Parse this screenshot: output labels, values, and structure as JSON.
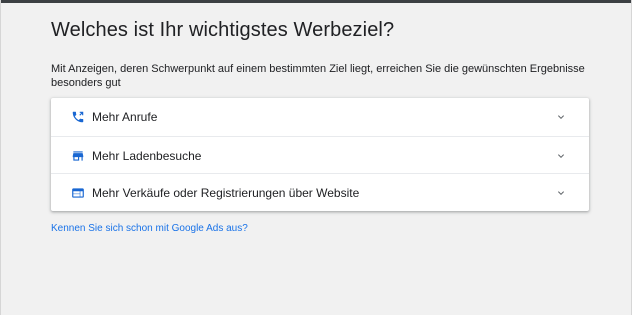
{
  "heading": "Welches ist Ihr wichtigstes Werbeziel?",
  "description": "Mit Anzeigen, deren Schwerpunkt auf einem bestimmten Ziel liegt, erreichen Sie die gewünschten Ergebnisse besonders gut",
  "goals": [
    {
      "label": "Mehr Anrufe",
      "icon": "phone-icon"
    },
    {
      "label": "Mehr Ladenbesuche",
      "icon": "store-icon"
    },
    {
      "label": "Mehr Verkäufe oder Registrierungen über Website",
      "icon": "web-icon"
    }
  ],
  "link_text": "Kennen Sie sich schon mit Google Ads aus?",
  "colors": {
    "accent": "#1a73e8",
    "icon_blue": "#1967d2",
    "background": "#f1f1f1",
    "card": "#ffffff",
    "text": "#202124",
    "chevron": "#5f6368"
  }
}
